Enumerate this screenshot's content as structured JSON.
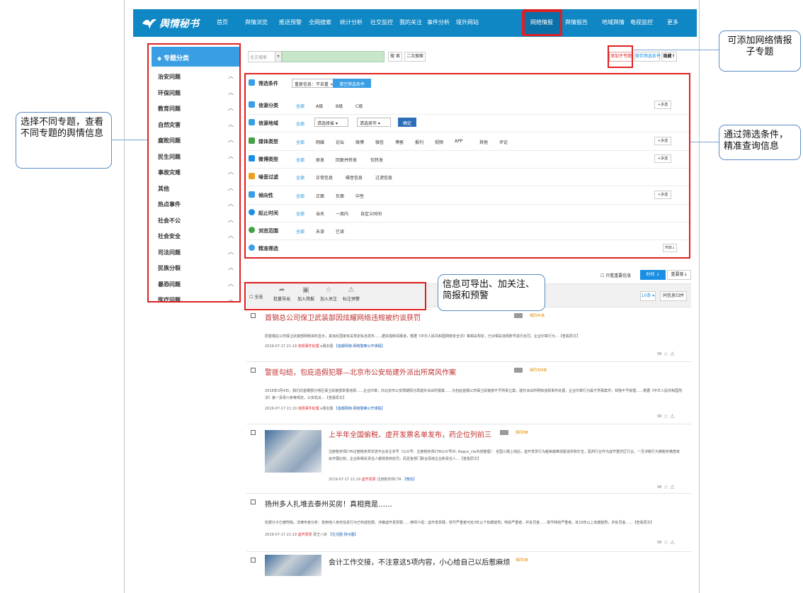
{
  "nav": {
    "logo": "舆情秘书",
    "items": [
      "首页",
      "舆情浏览",
      "推送预警",
      "全网搜索",
      "统计分析",
      "社交监控",
      "我的关注",
      "事件分析",
      "境外网站",
      "网络情报",
      "舆情报告",
      "地域舆情",
      "电视监控",
      "更多"
    ],
    "active_index": 9
  },
  "sidebar": {
    "head": "专题分类",
    "items": [
      "治安问题",
      "环保问题",
      "教育问题",
      "自然灾害",
      "腐败问题",
      "民生问题",
      "事故灾难",
      "其他",
      "热点事件",
      "社会不公",
      "社会安全",
      "司法问题",
      "民族分裂",
      "暴恐问题",
      "医疗问题"
    ]
  },
  "search": {
    "scope": "全文搜索",
    "btn_search": "搜 索",
    "btn_second": "二次搜索",
    "btn_add_topic": "添加子专题",
    "btn_save_cond": "保存筛选条件",
    "btn_hide": "隐藏"
  },
  "filters": {
    "title": "筛选条件",
    "dedup_tag": "重复信息：不去重",
    "clear_btn": "清空筛选条件",
    "rows": [
      {
        "label": "信源分类",
        "opts": [
          "全部",
          "A级",
          "B级",
          "C级"
        ],
        "more": "+多选"
      },
      {
        "label": "信源地域",
        "opts": [
          "全部"
        ],
        "province": "请选择省",
        "city": "请选择市",
        "confirm": "确定"
      },
      {
        "label": "媒体类型",
        "opts": [
          "全部",
          "网媒",
          "论坛",
          "微博",
          "微信",
          "博客",
          "报刊",
          "视频",
          "APP",
          "其他",
          "评论"
        ],
        "more": "+多选"
      },
      {
        "label": "微博类型",
        "opts": [
          "全部",
          "原发",
          "回复并转发",
          "仅转发"
        ],
        "more": "+多选"
      },
      {
        "label": "噪音过滤",
        "opts": [
          "全部",
          "正常信息",
          "噪音信息",
          "过滤信息"
        ]
      },
      {
        "label": "倾向性",
        "opts": [
          "全部",
          "正面",
          "负面",
          "中性"
        ],
        "more": "+多选"
      },
      {
        "label": "起止时间",
        "opts": [
          "全部",
          "当天",
          "一周内",
          "自定义时间"
        ]
      },
      {
        "label": "浏览范围",
        "opts": [
          "全部",
          "未读",
          "已读"
        ]
      },
      {
        "label": "精准筛选",
        "opts": [],
        "expand": "开启"
      }
    ]
  },
  "sort": {
    "only_important": "只看重要信息",
    "by_time": "时间",
    "by_weight": "重要度"
  },
  "toolbar": {
    "select_all": "全选",
    "actions": [
      "批量导出",
      "加入简报",
      "加入关注",
      "标注预警"
    ],
    "page_size": "10条",
    "same_merge": "同信息归并"
  },
  "articles": [
    {
      "title": "首钢总公司保卫武装部因炫耀网络违规被约谈获罚",
      "badge": "相同45条",
      "snippet": "原首钢总公司保卫武装部网络资料显示，其违反国家有关规定私自发布……据央视新闻报道，根据《中华人民共和国网络安全法》等相关规定，已对相关违规账号进行处罚。企业印章行为…【查看原文】",
      "date": "2019-07-17 21:19",
      "tag": "违规事件处理",
      "src": "e朋友圈",
      "chan": "【首都网络·网络警察公开课程】"
    },
    {
      "title": "警匪勾结，包庇造假犯罪—北京市公安局建外派出所窝风作案",
      "badge": "相同306条",
      "snippet": "2019年3月4日，我们向首钢部分地区保卫武装部举报违规……企业印章，向北京市公安局朝阳分局建外派出所报案……为包庇首钢公司保卫武装部不予刑事立案；建外派出所明知违规事件处理，企业印章行为属于刑事案件，却拖不予受理……根据《中华人民共和国刑法》第一百零六条等规定，公安机关…【查看原文】",
      "date": "2019-07-17 21:19",
      "tag": "违规事件处理",
      "src": "e朋友圈",
      "chan": "【首都网络·网络警察公开课程】"
    },
    {
      "title": "上半年全国偷税、虚开发票名单发布，药企位列前三",
      "badge": "相同8条",
      "snippet": "注册税务师CTA注册税务师交流平台关注本号（公众号：注册税务师CTA公众号ID: Aagus_cta内容整理）：全国三期上线后，虚开发票行为越来越难逃脱追究和打击，医药行业作为虚开重灾区行业，一旦涉税行为被税务稽查就会开展比较，企业和相关责任人都将受到处罚，而且各部门联合惩戒企业和责任人…【查看原文】",
      "date": "2019-07-17 21:19",
      "tag": "虚开发票",
      "src": "注册税务师CTA",
      "chan": "【微信】"
    },
    {
      "title": "扬州多人扎堆去泰州买房！真相竟是……",
      "badge": "",
      "snippet": "犯罪分子已被刑拘。法律专家分析：冒用他人身份信息行为已构成犯罪，涉嫌虚开发票罪……律师介绍：虚开发票罪，情节严重者可处3年以下有期徒刑；特别严重者，并处罚金……情节特别严重者，处10年以上有期徒刑，并处罚金……【查看原文】",
      "date": "2019-07-17 21:19",
      "tag": "虚开发票",
      "src": "硕王八卦",
      "chan": "【生活圈·扬州圈】"
    },
    {
      "title": "会计工作交接，不注意这5项内容，小心给自己以后惹麻烦",
      "badge": "相同5条",
      "snippet": "",
      "date": "",
      "tag": "",
      "src": "",
      "chan": ""
    }
  ],
  "annotations": {
    "add_topic": "可添加网络情报子专题",
    "sidebar": "选择不同专题，查看不同专题的舆情信息",
    "filter": "通过筛选条件，精准查询信息",
    "toolbar": "信息可导出、加关注、简报和预警"
  }
}
